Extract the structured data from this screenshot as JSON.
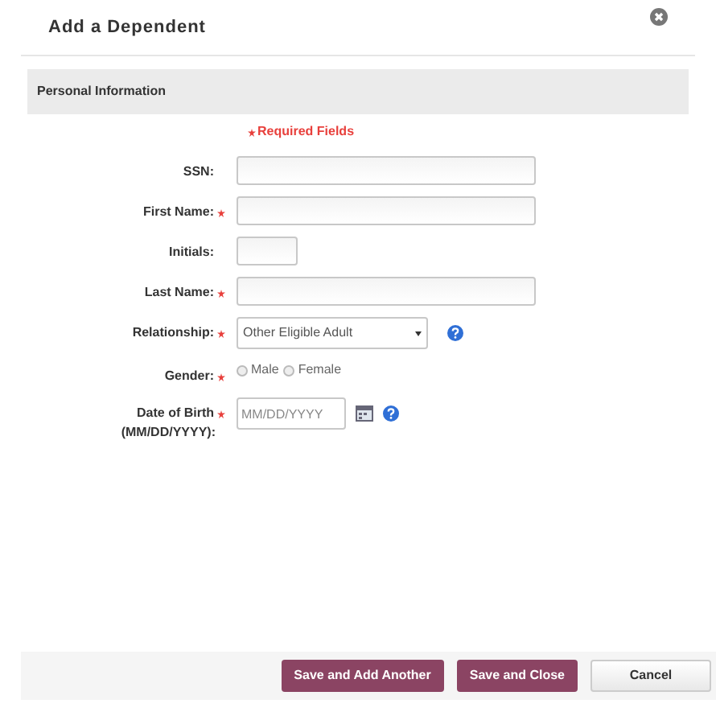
{
  "dialog": {
    "title": "Add a Dependent"
  },
  "section": {
    "title": "Personal Information"
  },
  "required_legend": "Required Fields",
  "fields": [
    {
      "kind": "text",
      "label": "SSN:",
      "required": false
    },
    {
      "kind": "text",
      "label": "First Name:",
      "required": true
    },
    {
      "kind": "short_text",
      "label": "Initials:",
      "required": false
    },
    {
      "kind": "text",
      "label": "Last Name:",
      "required": true
    },
    {
      "kind": "select",
      "label": "Relationship:",
      "required": true,
      "value": "Other Eligible Adult"
    },
    {
      "kind": "radio",
      "label": "Gender:",
      "required": true,
      "options": [
        {
          "label": "Male",
          "selected": false
        },
        {
          "label": "Female",
          "selected": false
        }
      ]
    },
    {
      "kind": "date",
      "label": "Date of Birth",
      "label_line_2": "(MM/DD/YYYY):",
      "required": true,
      "placeholder": "MM/DD/YYYY"
    }
  ],
  "buttons": [
    {
      "label": "Save and Add Another",
      "kind": "primary"
    },
    {
      "label": "Save and Close",
      "kind": "primary"
    },
    {
      "label": "Cancel",
      "kind": "secondary"
    }
  ]
}
